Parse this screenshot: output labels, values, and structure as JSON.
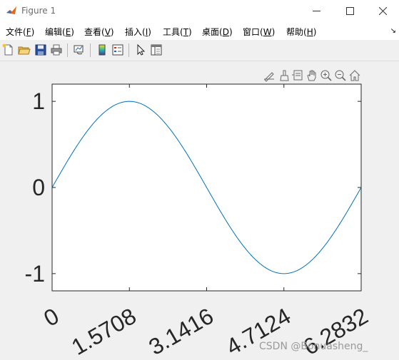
{
  "window": {
    "title": "Figure 1",
    "icons": {
      "app": "matlab-logo-icon",
      "minimize": "minimize-icon",
      "maximize": "maximize-icon",
      "close": "close-icon"
    }
  },
  "menu": {
    "items": [
      {
        "label": "文件(",
        "key": "F",
        "tail": ")"
      },
      {
        "label": "编辑(",
        "key": "E",
        "tail": ")"
      },
      {
        "label": "查看(",
        "key": "V",
        "tail": ")"
      },
      {
        "label": "插入(",
        "key": "I",
        "tail": ")"
      },
      {
        "label": "工具(",
        "key": "T",
        "tail": ")"
      },
      {
        "label": "桌面(",
        "key": "D",
        "tail": ")"
      },
      {
        "label": "窗口(",
        "key": "W",
        "tail": ")"
      },
      {
        "label": "帮助(",
        "key": "H",
        "tail": ")"
      }
    ],
    "overflow_icon": "dock-arrow-icon"
  },
  "toolbar": {
    "buttons": [
      "new-figure-icon",
      "open-icon",
      "save-icon",
      "print-icon",
      "link-plot-icon",
      "insert-colorbar-icon",
      "insert-legend-icon",
      "edit-plot-icon",
      "property-inspector-icon"
    ]
  },
  "axes_toolbar": {
    "buttons": [
      "brush-export-icon",
      "brush-icon",
      "datatips-icon",
      "pan-icon",
      "zoom-in-icon",
      "zoom-out-icon",
      "home-icon"
    ]
  },
  "colors": {
    "line": "#0072bd",
    "axes_bg": "#ffffff",
    "figure_bg": "#f0f0f0",
    "axis": "#262626"
  },
  "chart_data": {
    "type": "line",
    "function": "sin(x)",
    "x_range": [
      0,
      6.2832
    ],
    "samples": 200,
    "xlim": [
      0,
      6.2832
    ],
    "ylim": [
      -1.2,
      1.2
    ],
    "xticks": [
      0,
      1.5708,
      3.1416,
      4.7124,
      6.2832
    ],
    "xtick_labels": [
      "0",
      "1.5708",
      "3.1416",
      "4.7124",
      "6.2832"
    ],
    "yticks": [
      -1,
      0,
      1
    ],
    "ytick_labels": [
      "-1",
      "0",
      "1"
    ],
    "xtick_rotation": 30,
    "grid": false
  },
  "watermark": "CSDN @Bonuasheng_"
}
